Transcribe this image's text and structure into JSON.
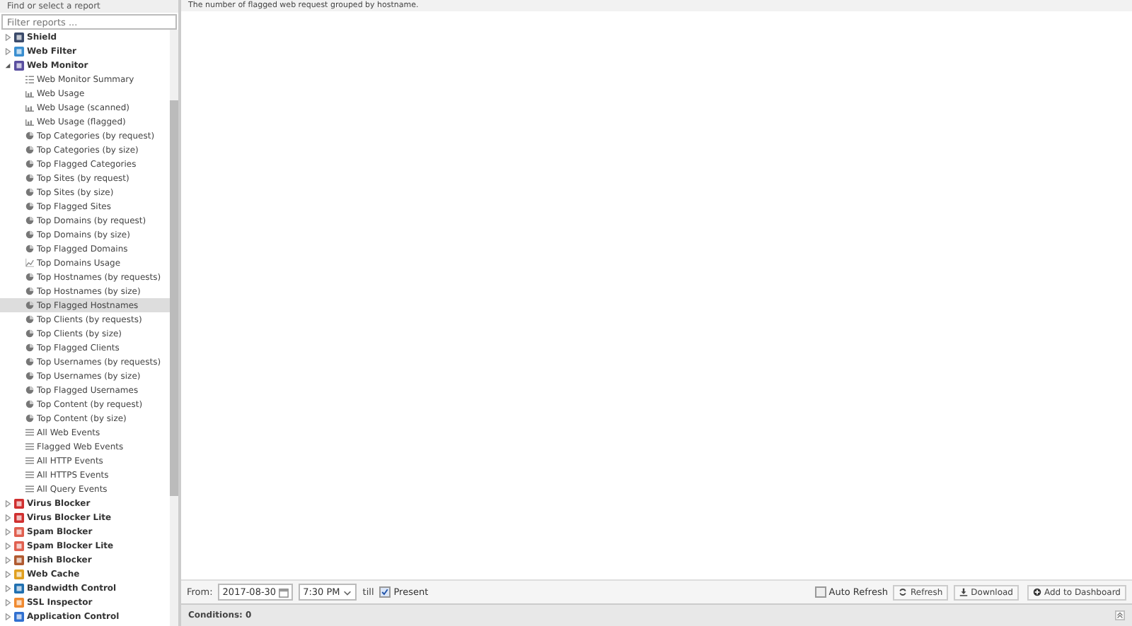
{
  "sidebar": {
    "title": "Find or select a report",
    "filter": {
      "placeholder": "Filter reports ..."
    },
    "tree": [
      {
        "label": "Shield",
        "color": "#3a4a6a",
        "expanded": false
      },
      {
        "label": "Web Filter",
        "color": "#3b8fd0",
        "expanded": false
      },
      {
        "label": "Web Monitor",
        "color": "#5a4fa0",
        "expanded": true,
        "children": [
          {
            "label": "Web Monitor Summary",
            "kind": "text",
            "selected": false
          },
          {
            "label": "Web Usage",
            "kind": "bar",
            "selected": false
          },
          {
            "label": "Web Usage (scanned)",
            "kind": "bar",
            "selected": false
          },
          {
            "label": "Web Usage (flagged)",
            "kind": "bar",
            "selected": false
          },
          {
            "label": "Top Categories (by request)",
            "kind": "pie",
            "selected": false
          },
          {
            "label": "Top Categories (by size)",
            "kind": "pie",
            "selected": false
          },
          {
            "label": "Top Flagged Categories",
            "kind": "pie",
            "selected": false
          },
          {
            "label": "Top Sites (by request)",
            "kind": "pie",
            "selected": false
          },
          {
            "label": "Top Sites (by size)",
            "kind": "pie",
            "selected": false
          },
          {
            "label": "Top Flagged Sites",
            "kind": "pie",
            "selected": false
          },
          {
            "label": "Top Domains (by request)",
            "kind": "pie",
            "selected": false
          },
          {
            "label": "Top Domains (by size)",
            "kind": "pie",
            "selected": false
          },
          {
            "label": "Top Flagged Domains",
            "kind": "pie",
            "selected": false
          },
          {
            "label": "Top Domains Usage",
            "kind": "line",
            "selected": false
          },
          {
            "label": "Top Hostnames (by requests)",
            "kind": "pie",
            "selected": false
          },
          {
            "label": "Top Hostnames (by size)",
            "kind": "pie",
            "selected": false
          },
          {
            "label": "Top Flagged Hostnames",
            "kind": "pie",
            "selected": true
          },
          {
            "label": "Top Clients (by requests)",
            "kind": "pie",
            "selected": false
          },
          {
            "label": "Top Clients (by size)",
            "kind": "pie",
            "selected": false
          },
          {
            "label": "Top Flagged Clients",
            "kind": "pie",
            "selected": false
          },
          {
            "label": "Top Usernames (by requests)",
            "kind": "pie",
            "selected": false
          },
          {
            "label": "Top Usernames (by size)",
            "kind": "pie",
            "selected": false
          },
          {
            "label": "Top Flagged Usernames",
            "kind": "pie",
            "selected": false
          },
          {
            "label": "Top Content (by request)",
            "kind": "pie",
            "selected": false
          },
          {
            "label": "Top Content (by size)",
            "kind": "pie",
            "selected": false
          },
          {
            "label": "All Web Events",
            "kind": "list",
            "selected": false
          },
          {
            "label": "Flagged Web Events",
            "kind": "list",
            "selected": false
          },
          {
            "label": "All HTTP Events",
            "kind": "list",
            "selected": false
          },
          {
            "label": "All HTTPS Events",
            "kind": "list",
            "selected": false
          },
          {
            "label": "All Query Events",
            "kind": "list",
            "selected": false
          }
        ]
      },
      {
        "label": "Virus Blocker",
        "color": "#d03030",
        "expanded": false
      },
      {
        "label": "Virus Blocker Lite",
        "color": "#d03030",
        "expanded": false
      },
      {
        "label": "Spam Blocker",
        "color": "#e06050",
        "expanded": false
      },
      {
        "label": "Spam Blocker Lite",
        "color": "#e06050",
        "expanded": false
      },
      {
        "label": "Phish Blocker",
        "color": "#b05a30",
        "expanded": false
      },
      {
        "label": "Web Cache",
        "color": "#e0a020",
        "expanded": false
      },
      {
        "label": "Bandwidth Control",
        "color": "#2070b0",
        "expanded": false
      },
      {
        "label": "SSL Inspector",
        "color": "#f08a30",
        "expanded": false
      },
      {
        "label": "Application Control",
        "color": "#3070d0",
        "expanded": false
      }
    ]
  },
  "report": {
    "description": "The number of flagged web request grouped by hostname."
  },
  "toolbar": {
    "from_label": "From:",
    "date": "2017-08-30",
    "time": "7:30 PM",
    "till_label": "till",
    "present": {
      "label": "Present",
      "checked": true
    },
    "auto_refresh": {
      "label": "Auto Refresh",
      "checked": false
    },
    "buttons": [
      "Refresh",
      "Download",
      "Add to Dashboard"
    ]
  },
  "conditions": "Conditions: 0"
}
